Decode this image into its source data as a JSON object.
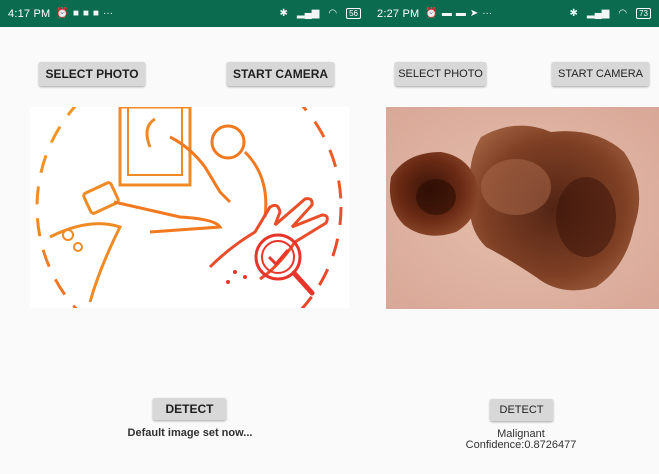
{
  "left": {
    "statusbar": {
      "time": "4:17 PM",
      "icons": [
        "alarm-icon",
        "notification-icon",
        "notification-icon",
        "notification-icon",
        "more-icon"
      ],
      "right_icons": [
        "bluetooth-icon",
        "signal-icon",
        "wifi-icon"
      ],
      "battery": "56"
    },
    "buttons": {
      "select_photo": "SELECT PHOTO",
      "start_camera": "START CAMERA",
      "detect": "DETECT"
    },
    "result_text": "Default image set now..."
  },
  "right": {
    "statusbar": {
      "time": "2:27 PM",
      "icons": [
        "alarm-icon",
        "message-icon",
        "message-icon",
        "send-icon",
        "more-icon"
      ],
      "right_icons": [
        "bluetooth-icon",
        "signal-icon",
        "wifi-icon"
      ],
      "battery": "73"
    },
    "buttons": {
      "select_photo": "SELECT PHOTO",
      "start_camera": "START CAMERA",
      "detect": "DETECT"
    },
    "result": {
      "label": "Malignant",
      "confidence": "Confidence:0.8726477"
    }
  },
  "colors": {
    "statusbar": "#0b6b4f",
    "button": "#d8d8d8",
    "illustration_orange": "#f08a24",
    "illustration_red": "#e8352b"
  }
}
